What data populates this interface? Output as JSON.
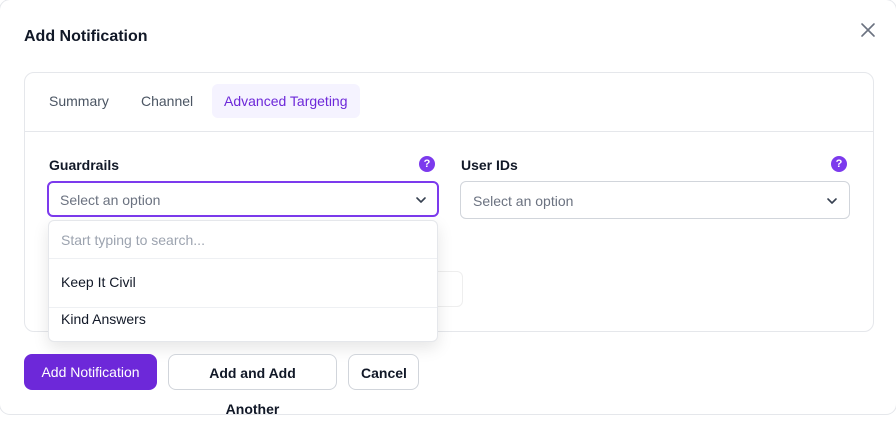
{
  "modal": {
    "title": "Add Notification"
  },
  "tabs": [
    {
      "label": "Summary",
      "active": false
    },
    {
      "label": "Channel",
      "active": false
    },
    {
      "label": "Advanced Targeting",
      "active": true
    }
  ],
  "fields": {
    "guardrails": {
      "label": "Guardrails",
      "placeholder": "Select an option",
      "help": "?"
    },
    "user_ids": {
      "label": "User IDs",
      "placeholder": "Select an option",
      "help": "?"
    }
  },
  "dropdown": {
    "search_placeholder": "Start typing to search...",
    "options": [
      "Keep It Civil",
      "Kind Answers"
    ]
  },
  "actions": {
    "primary": "Add Notification",
    "add_another": "Add and Add Another",
    "cancel": "Cancel"
  },
  "colors": {
    "accent": "#6d28d9",
    "focus": "#7c3aed"
  }
}
